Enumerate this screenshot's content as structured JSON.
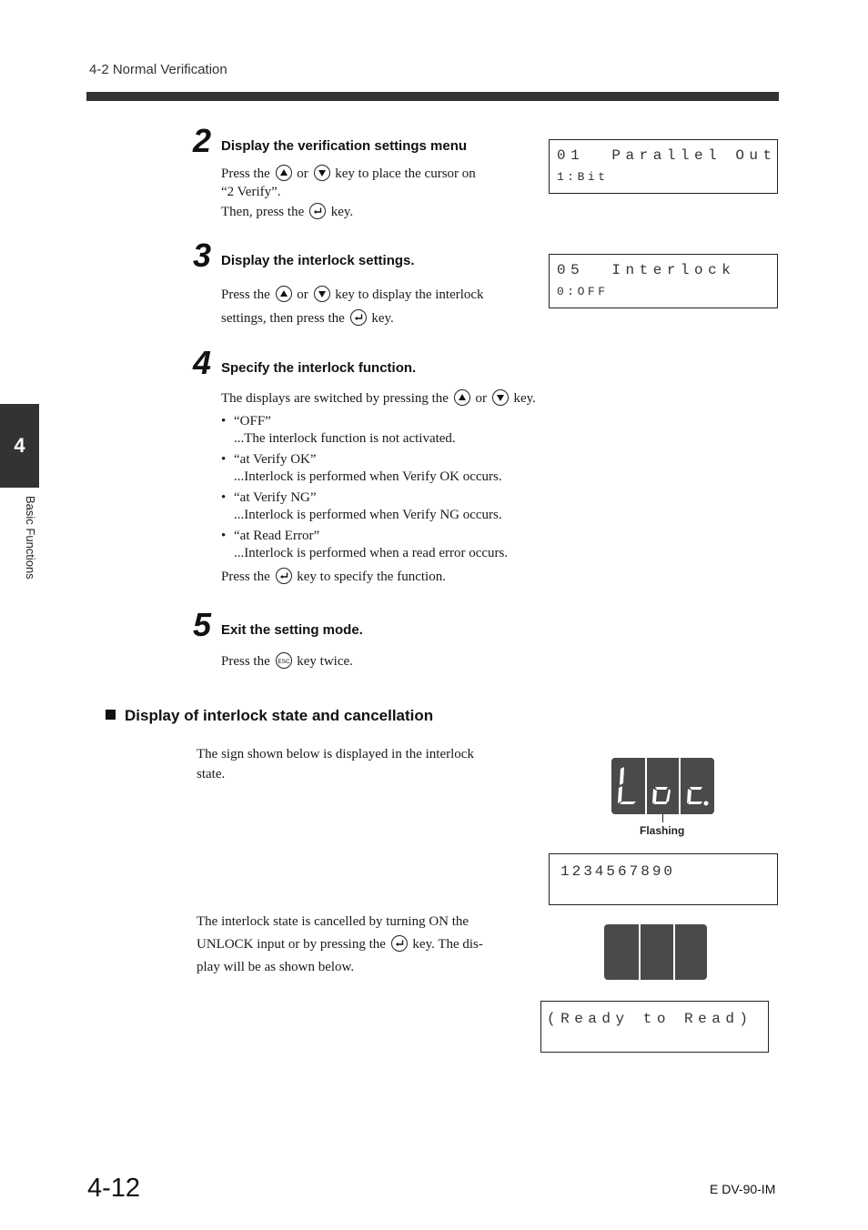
{
  "header": {
    "section_title": "4-2  Normal Verification"
  },
  "chapter_tab": {
    "number": "4",
    "label": "Basic Functions"
  },
  "steps": [
    {
      "number": "2",
      "title": "Display the verification settings menu",
      "text_a": "Press the",
      "text_or": "or",
      "text_b": "key to place the cursor on",
      "text_c": "“2 Verify”.",
      "text_d": "Then, press the",
      "text_e": "key.",
      "lcd": {
        "line1": "01  Parallel Out",
        "line2": "1:Bit"
      }
    },
    {
      "number": "3",
      "title": "Display the interlock settings.",
      "text_a": "Press the",
      "text_or": "or",
      "text_b": "key to display the interlock",
      "text_c": "settings, then press the",
      "text_d": "key.",
      "lcd": {
        "line1": "05  Interlock",
        "line2": "0:OFF"
      }
    },
    {
      "number": "4",
      "title": "Specify the interlock function.",
      "intro_a": "The displays are switched by pressing the",
      "intro_or": "or",
      "intro_b": "key.",
      "options": [
        {
          "name": "“OFF”",
          "desc": "...The interlock function is not activated."
        },
        {
          "name": "“at Verify OK”",
          "desc": "...Interlock is performed when Verify OK occurs."
        },
        {
          "name": "“at Verify NG”",
          "desc": "...Interlock is performed when Verify NG occurs."
        },
        {
          "name": "“at Read Error”",
          "desc": "...Interlock is performed when a read error occurs."
        }
      ],
      "outro_a": "Press the",
      "outro_b": "key to specify the function."
    },
    {
      "number": "5",
      "title": "Exit the setting mode.",
      "text_a": "Press the",
      "text_b": "key twice."
    }
  ],
  "interlock_section": {
    "heading": "Display of interlock state and cancellation",
    "para1_line1": "The sign shown below is displayed in the interlock",
    "para1_line2": "state.",
    "seven_seg_text": "Loc.",
    "flashing_label": "Flashing",
    "lcd_counter": {
      "line1": "1234567890",
      "line2": ""
    },
    "para2_line1": "The interlock state is cancelled by turning ON the",
    "para2_line2a": "UNLOCK input or by pressing the",
    "para2_line2b": "key. The dis-",
    "para2_line3": "play will be as shown below.",
    "lcd_ready": {
      "line1": "(Ready to Read)",
      "line2": ""
    }
  },
  "keys": {
    "up": "up-key",
    "down": "down-key",
    "enter": "enter-key",
    "esc": "ESC"
  },
  "footer": {
    "page_number": "4-12",
    "doc_id": "E DV-90-IM"
  }
}
